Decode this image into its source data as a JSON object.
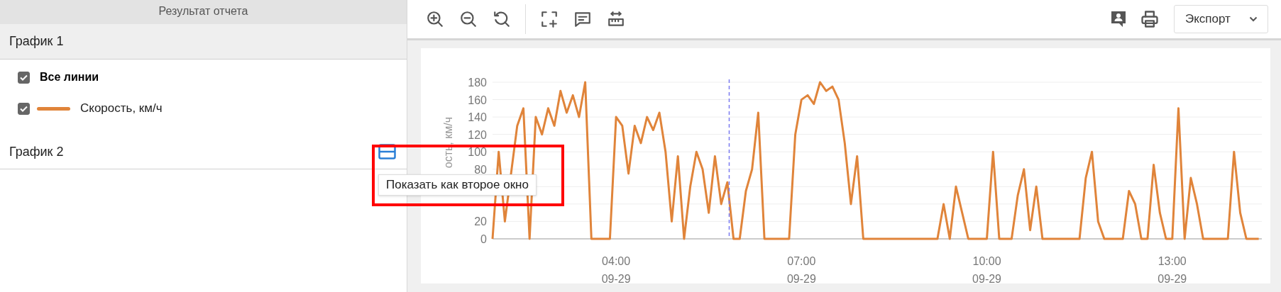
{
  "sidebar": {
    "header": "Результат отчета",
    "groups": [
      {
        "title": "График 1",
        "items": [
          {
            "kind": "all",
            "label": "Все линии",
            "checked": true
          },
          {
            "kind": "series",
            "checked": true
          }
        ]
      },
      {
        "title": "График 2",
        "action": {
          "tooltip": "Показать как второе окно",
          "highlighted": true
        }
      }
    ]
  },
  "toolbar": {
    "export": {
      "label": "Экспорт"
    }
  },
  "chart": {
    "chart_data": {
      "type": "line",
      "ylabel": "ость, км/ч",
      "ylim": [
        0,
        180
      ],
      "yticks": [
        0,
        20,
        80,
        100,
        120,
        140,
        160,
        180
      ],
      "grid": true,
      "categories": [
        null,
        null,
        null,
        null,
        null,
        null,
        null,
        null,
        null,
        null,
        null,
        null,
        null,
        null,
        null,
        null,
        null,
        null,
        null,
        null,
        "04:00\n09-29",
        null,
        null,
        null,
        null,
        null,
        null,
        null,
        null,
        null,
        null,
        null,
        null,
        null,
        null,
        null,
        null,
        null,
        null,
        null,
        null,
        null,
        null,
        null,
        null,
        null,
        null,
        null,
        null,
        null,
        "07:00\n09-29",
        null,
        null,
        null,
        null,
        null,
        null,
        null,
        null,
        null,
        null,
        null,
        null,
        null,
        null,
        null,
        null,
        null,
        null,
        null,
        null,
        null,
        null,
        null,
        null,
        null,
        null,
        null,
        null,
        null,
        "10:00\n09-29",
        null,
        null,
        null,
        null,
        null,
        null,
        null,
        null,
        null,
        null,
        null,
        null,
        null,
        null,
        null,
        null,
        null,
        null,
        null,
        null,
        null,
        null,
        null,
        null,
        null,
        null,
        null,
        null,
        null,
        "13:00\n09-29",
        null,
        null,
        null,
        null,
        null,
        null,
        null,
        null,
        null,
        null,
        null,
        null,
        null,
        null
      ],
      "series": [
        {
          "name": "Скорость, км/ч",
          "color": "#e0843a",
          "values": [
            0,
            100,
            20,
            75,
            130,
            150,
            0,
            140,
            120,
            150,
            130,
            170,
            145,
            165,
            140,
            180,
            0,
            0,
            0,
            0,
            140,
            130,
            75,
            130,
            110,
            140,
            125,
            145,
            100,
            20,
            95,
            0,
            60,
            100,
            80,
            30,
            95,
            40,
            65,
            0,
            0,
            55,
            80,
            145,
            0,
            0,
            0,
            0,
            0,
            120,
            160,
            165,
            155,
            180,
            170,
            175,
            160,
            110,
            40,
            95,
            0,
            0,
            0,
            0,
            0,
            0,
            0,
            0,
            0,
            0,
            0,
            0,
            0,
            40,
            0,
            60,
            30,
            0,
            0,
            0,
            0,
            100,
            0,
            0,
            0,
            50,
            80,
            10,
            60,
            0,
            0,
            0,
            0,
            0,
            0,
            0,
            70,
            100,
            20,
            0,
            0,
            0,
            0,
            55,
            40,
            0,
            0,
            85,
            30,
            0,
            0,
            150,
            0,
            70,
            40,
            0,
            0,
            0,
            0,
            0,
            100,
            30,
            0,
            0,
            0
          ]
        }
      ]
    }
  }
}
